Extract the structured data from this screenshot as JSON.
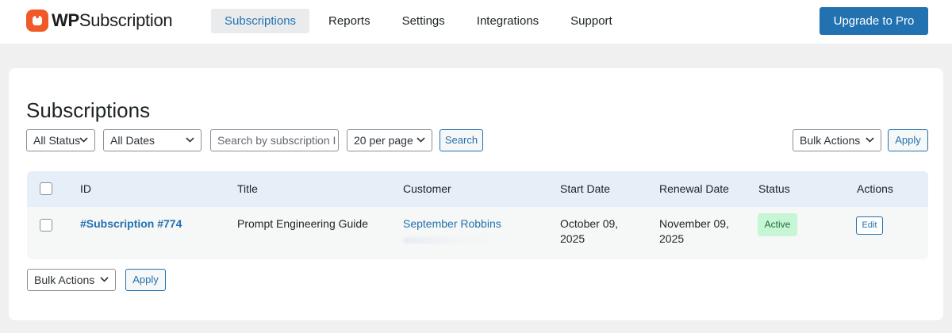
{
  "brand": {
    "logo_wp": "WP",
    "logo_rest": "Subscription",
    "accent": "#2271b1",
    "logo_color": "#f05a28"
  },
  "nav": {
    "items": [
      {
        "label": "Subscriptions",
        "active": true
      },
      {
        "label": "Reports",
        "active": false
      },
      {
        "label": "Settings",
        "active": false
      },
      {
        "label": "Integrations",
        "active": false
      },
      {
        "label": "Support",
        "active": false
      }
    ],
    "upgrade_label": "Upgrade to Pro"
  },
  "page": {
    "title": "Subscriptions"
  },
  "filters": {
    "status": "All Status",
    "dates": "All Dates",
    "search_placeholder": "Search by subscription I",
    "per_page": "20 per page",
    "search_button": "Search",
    "bulk_actions": "Bulk Actions",
    "apply": "Apply"
  },
  "table": {
    "columns": [
      "ID",
      "Title",
      "Customer",
      "Start Date",
      "Renewal Date",
      "Status",
      "Actions"
    ],
    "rows": [
      {
        "id": "#Subscription #774",
        "title": "Prompt Engineering Guide",
        "customer": "September Robbins",
        "start_date_line1": "October 09,",
        "start_date_line2": "2025",
        "renewal_date_line1": "November 09,",
        "renewal_date_line2": "2025",
        "status": "Active",
        "action": "Edit"
      }
    ]
  },
  "footer": {
    "bulk_actions": "Bulk Actions",
    "apply": "Apply"
  },
  "colors": {
    "status_active_bg": "#c6f6d5",
    "status_active_text": "#1e6b3a",
    "header_row_bg": "#e6eef8"
  }
}
